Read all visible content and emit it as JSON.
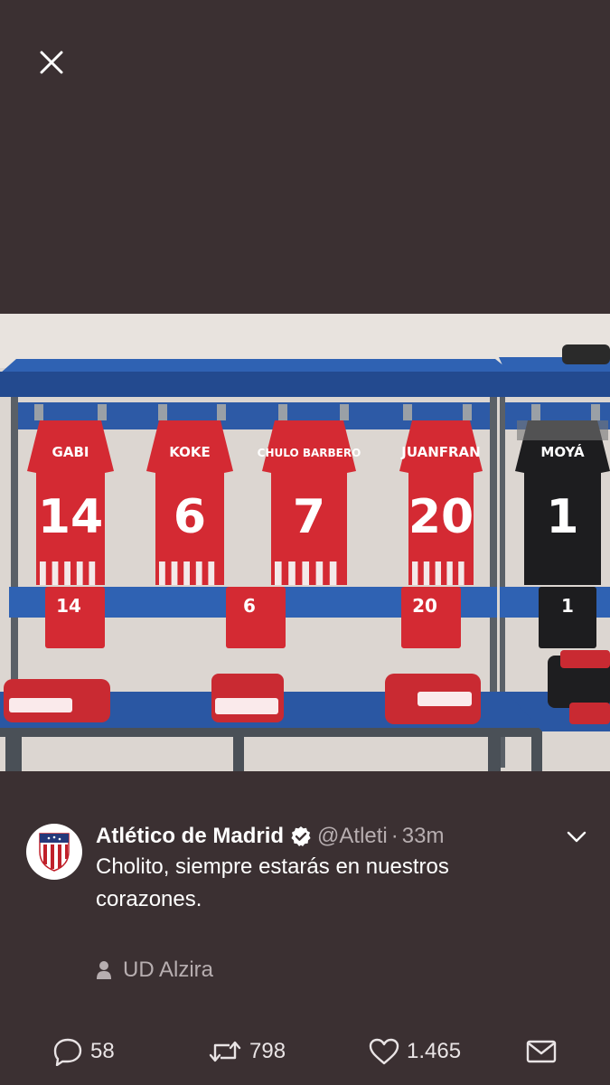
{
  "viewer": {
    "close_icon": "close-icon"
  },
  "photo": {
    "jerseys": [
      {
        "name": "GABI",
        "number": "14",
        "color": "#d42a33"
      },
      {
        "name": "KOKE",
        "number": "6",
        "color": "#d42a33"
      },
      {
        "name": "CHULO BARBERO",
        "number": "7",
        "color": "#d42a33"
      },
      {
        "name": "JUANFRAN",
        "number": "20",
        "color": "#d42a33"
      },
      {
        "name": "MOYÁ",
        "number": "1",
        "color": "#1d1d1f"
      }
    ],
    "shorts_numbers": [
      "14",
      "6",
      "20",
      "1"
    ]
  },
  "tweet": {
    "author_name": "Atlético de Madrid",
    "handle": "@Atleti",
    "separator": "·",
    "time": "33m",
    "text": "Cholito, siempre estarás en nuestros corazones.",
    "location": "UD Alzira",
    "actions": {
      "reply_count": "58",
      "retweet_count": "798",
      "like_count": "1.465"
    }
  },
  "colors": {
    "background": "#3b3032",
    "secondary_text": "#b7aeb0",
    "verified": "#ffffff"
  }
}
